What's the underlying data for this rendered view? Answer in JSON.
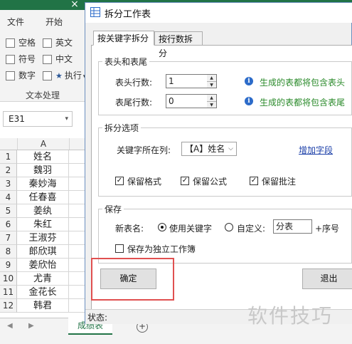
{
  "excel": {
    "ribbon_tabs": [
      "文件",
      "开始"
    ],
    "ribbon_items": {
      "space": "空格",
      "english": "英文",
      "symbol": "符号",
      "chinese": "中文",
      "digit": "数字",
      "execute": "执行"
    },
    "group_label": "文本处理",
    "name_box": "E31",
    "column_header": "A",
    "rows": [
      {
        "num": "1",
        "value": "姓名"
      },
      {
        "num": "2",
        "value": "魏羽"
      },
      {
        "num": "3",
        "value": "秦妙海"
      },
      {
        "num": "4",
        "value": "任春喜"
      },
      {
        "num": "5",
        "value": "姜纨"
      },
      {
        "num": "6",
        "value": "朱红"
      },
      {
        "num": "7",
        "value": "王淑芬"
      },
      {
        "num": "8",
        "value": "郎欣琪"
      },
      {
        "num": "9",
        "value": "姜欣怡"
      },
      {
        "num": "10",
        "value": "尤青"
      },
      {
        "num": "11",
        "value": "金花长"
      },
      {
        "num": "12",
        "value": "韩君"
      }
    ],
    "sheet_tab": "成绩表"
  },
  "dialog": {
    "title": "拆分工作表",
    "tabs": [
      "按关键字拆分",
      "按行数拆分"
    ],
    "header_footer": {
      "group_title": "表头和表尾",
      "header_rows_label": "表头行数:",
      "header_rows_value": "1",
      "header_hint": "生成的表都将包含表头",
      "footer_rows_label": "表尾行数:",
      "footer_rows_value": "0",
      "footer_hint": "生成的表都将包含表尾"
    },
    "split_options": {
      "group_title": "拆分选项",
      "keyword_col_label": "关键字所在列:",
      "keyword_col_value": "【A】姓名",
      "add_field_link": "增加字段",
      "keep_format": "保留格式",
      "keep_formula": "保留公式",
      "keep_comment": "保留批注"
    },
    "save": {
      "group_title": "保存",
      "new_name_label": "新表名:",
      "use_keyword": "使用关键字",
      "custom_label": "自定义:",
      "custom_value": "分表",
      "suffix": "+序号",
      "save_independent": "保存为独立工作簿"
    },
    "ok_button": "确定",
    "exit_button": "退出",
    "status_label": "状态:"
  },
  "watermark": "软件技巧",
  "colors": {
    "excel_green": "#217346",
    "hint_green": "#2a8a2a",
    "highlight_red": "#e05050",
    "link_blue": "#1a3ea8"
  }
}
